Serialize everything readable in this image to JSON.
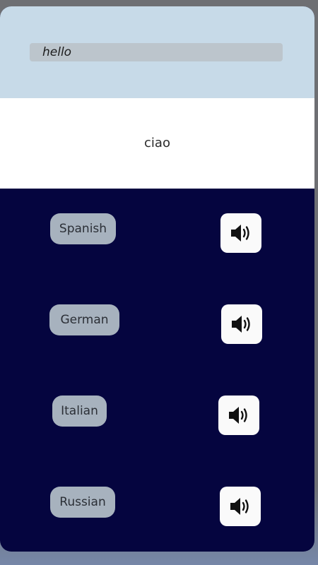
{
  "input": {
    "value": "hello"
  },
  "output": {
    "text": "ciao"
  },
  "languages": [
    {
      "label": "Spanish",
      "speak_icon": "speaker-icon"
    },
    {
      "label": "German",
      "speak_icon": "speaker-icon"
    },
    {
      "label": "Italian",
      "speak_icon": "speaker-icon"
    },
    {
      "label": "Russian",
      "speak_icon": "speaker-icon"
    }
  ],
  "colors": {
    "input_area_bg": "#c7dae8",
    "input_field_bg": "#bcc5cc",
    "output_area_bg": "#ffffff",
    "languages_panel_bg": "#05053f",
    "language_button_bg": "#a7b2be",
    "speak_button_bg": "#fafafa"
  }
}
